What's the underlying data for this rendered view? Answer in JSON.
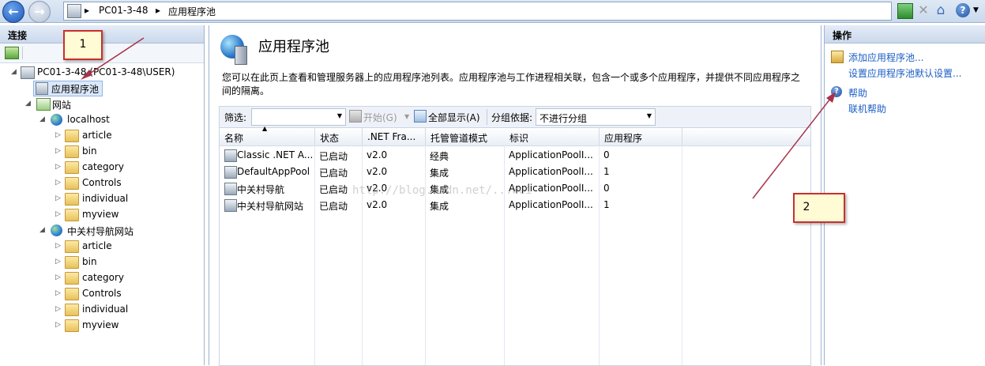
{
  "address_bar": {
    "breadcrumbs": [
      "PC01-3-48",
      "应用程序池"
    ]
  },
  "left_panel": {
    "title": "连接",
    "tree": {
      "server": "PC01-3-48 (PC01-3-48\\USER)",
      "app_pools": "应用程序池",
      "sites_label": "网站",
      "sites": [
        {
          "name": "localhost",
          "folders": [
            "article",
            "bin",
            "category",
            "Controls",
            "individual",
            "myview"
          ]
        },
        {
          "name": "中关村导航网站",
          "folders": [
            "article",
            "bin",
            "category",
            "Controls",
            "individual",
            "myview"
          ]
        }
      ]
    }
  },
  "center_panel": {
    "title": "应用程序池",
    "description": "您可以在此页上查看和管理服务器上的应用程序池列表。应用程序池与工作进程相关联，包含一个或多个应用程序，并提供不同应用程序之间的隔离。",
    "filter_bar": {
      "filter_label": "筛选:",
      "start_label": "开始(G)",
      "show_all_label": "全部显示(A)",
      "group_by_label": "分组依据:",
      "group_by_value": "不进行分组"
    },
    "table": {
      "columns": [
        "名称",
        "状态",
        ".NET Fra...",
        "托管管道模式",
        "标识",
        "应用程序"
      ],
      "rows": [
        [
          "Classic .NET A...",
          "已启动",
          "v2.0",
          "经典",
          "ApplicationPoolI...",
          "0"
        ],
        [
          "DefaultAppPool",
          "已启动",
          "v2.0",
          "集成",
          "ApplicationPoolI...",
          "1"
        ],
        [
          "中关村导航",
          "已启动",
          "v2.0",
          "集成",
          "ApplicationPoolI...",
          "0"
        ],
        [
          "中关村导航网站",
          "已启动",
          "v2.0",
          "集成",
          "ApplicationPoolI...",
          "1"
        ]
      ]
    }
  },
  "right_panel": {
    "title": "操作",
    "actions": [
      "添加应用程序池...",
      "设置应用程序池默认设置..."
    ],
    "help": [
      "帮助",
      "联机帮助"
    ]
  },
  "annotations": {
    "callout_1": "1",
    "callout_2": "2",
    "watermark": "http://blog.csdn.net/...wei"
  },
  "colors": {
    "link": "#1a5ec4",
    "callout_border": "#c9302c",
    "arrow": "#a8324a"
  }
}
